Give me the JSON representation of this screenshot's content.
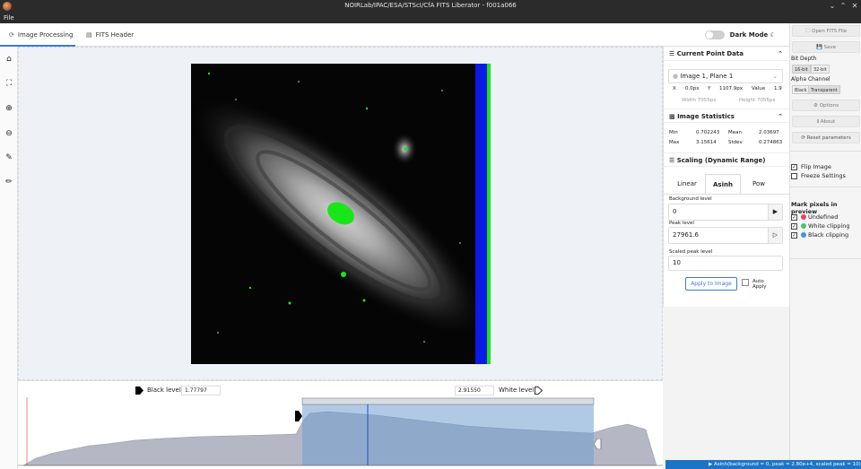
{
  "window": {
    "title": "NOIRLab/IPAC/ESA/STScI/CfA FITS Liberator - f001a066"
  },
  "menu": {
    "file": "File"
  },
  "tabs": [
    {
      "label": "Image Processing",
      "icon": "spinner-icon"
    },
    {
      "label": "FITS Header",
      "icon": "table-icon"
    }
  ],
  "dark_mode": {
    "label": "Dark Mode"
  },
  "left_tools": [
    "home-icon",
    "fit-screen-icon",
    "zoom-in-icon",
    "zoom-out-icon",
    "eyedropper-icon",
    "eyedropper-outline-icon"
  ],
  "levels": {
    "black_label": "Black level",
    "black_value": "1.77797",
    "white_label": "White level",
    "white_value": "2.91550"
  },
  "current_point": {
    "title": "Current Point Data",
    "plane": "Image 1, Plane 1",
    "x_label": "X",
    "x_value": "0.0px",
    "y_label": "Y",
    "y_value": "1107.9px",
    "value_label": "Value",
    "value": "1.9",
    "width_text": "Width 7055px",
    "height_text": "Height 7055px"
  },
  "stats": {
    "title": "Image Statistics",
    "min_label": "Min",
    "min": "0.702243",
    "mean_label": "Mean",
    "mean": "2.03697",
    "max_label": "Max",
    "max": "3.15614",
    "stdev_label": "Stdev",
    "stdev": "0.274863"
  },
  "scaling": {
    "title": "Scaling (Dynamic Range)",
    "tabs": [
      "Linear",
      "Asinh",
      "Pow"
    ],
    "active_tab": "Asinh",
    "bg_label": "Background level",
    "bg_value": "0",
    "peak_label": "Peak level",
    "peak_value": "27961.6",
    "scaled_label": "Scaled peak level",
    "scaled_value": "10",
    "apply_label": "Apply to Image",
    "auto_apply_label": "Auto Apply"
  },
  "sidebar": {
    "open_label": "Open FITS File",
    "save_label": "Save",
    "bit_depth_label": "Bit Depth",
    "bit_16": "16-bit",
    "bit_32": "32-bit",
    "alpha_label": "Alpha Channel",
    "alpha_black": "Black",
    "alpha_transparent": "Transparent",
    "options_label": "Options",
    "about_label": "About",
    "reset_label": "Reset parameters",
    "flip_label": "Flip Image",
    "freeze_label": "Freeze Settings",
    "mark_title": "Mark pixels in preview",
    "undefined_label": "Undefined",
    "white_clip_label": "White clipping",
    "black_clip_label": "Black clipping"
  },
  "colors": {
    "accent": "#3a7bd5",
    "undefined": "#e8446a",
    "white_clipping": "#4fbf6b",
    "black_clipping": "#4a8ee0",
    "clip_green": "#19e619",
    "clip_blue": "#0a1be6"
  },
  "status": {
    "text": "Asinh(background = 0, peak = 2.80e+4, scaled peak = 10)"
  }
}
